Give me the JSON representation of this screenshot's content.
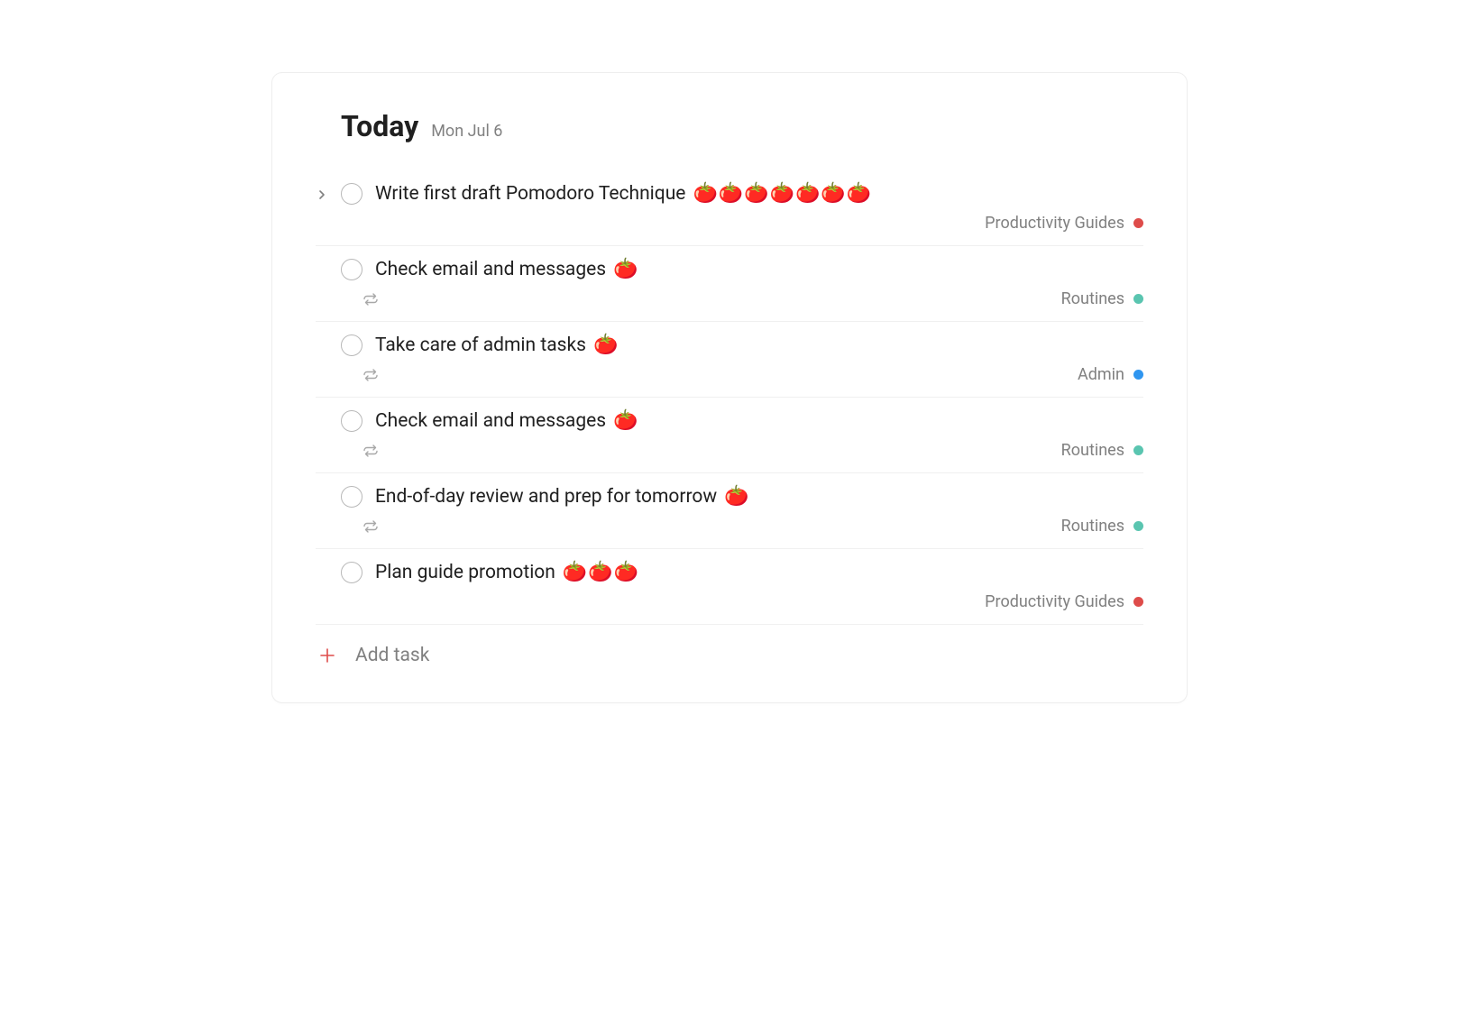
{
  "header": {
    "title": "Today",
    "date": "Mon Jul 6"
  },
  "tomato_emoji": "🍅",
  "tasks": [
    {
      "title": "Write first draft Pomodoro Technique",
      "tomato_count": 7,
      "has_subtasks": true,
      "recurring": false,
      "project": {
        "name": "Productivity Guides",
        "color": "#de4c4a"
      }
    },
    {
      "title": "Check email and messages",
      "tomato_count": 1,
      "has_subtasks": false,
      "recurring": true,
      "project": {
        "name": "Routines",
        "color": "#5ac5b0"
      }
    },
    {
      "title": "Take care of admin tasks",
      "tomato_count": 1,
      "has_subtasks": false,
      "recurring": true,
      "project": {
        "name": "Admin",
        "color": "#2f96f0"
      }
    },
    {
      "title": "Check email and messages",
      "tomato_count": 1,
      "has_subtasks": false,
      "recurring": true,
      "project": {
        "name": "Routines",
        "color": "#5ac5b0"
      }
    },
    {
      "title": "End-of-day review and prep for tomorrow",
      "tomato_count": 1,
      "has_subtasks": false,
      "recurring": true,
      "project": {
        "name": "Routines",
        "color": "#5ac5b0"
      }
    },
    {
      "title": "Plan guide promotion",
      "tomato_count": 3,
      "has_subtasks": false,
      "recurring": false,
      "project": {
        "name": "Productivity Guides",
        "color": "#de4c4a"
      }
    }
  ],
  "add_task": {
    "label": "Add task"
  }
}
